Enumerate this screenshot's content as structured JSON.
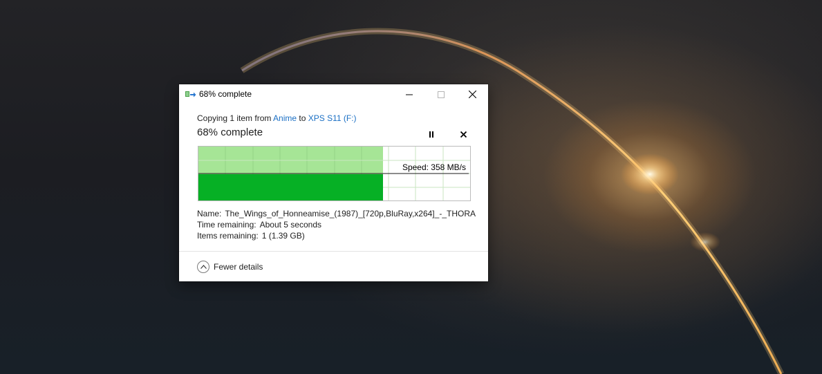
{
  "window": {
    "title": "68% complete"
  },
  "copy": {
    "prefix": "Copying 1 item from ",
    "source": "Anime",
    "connector": " to ",
    "destination": "XPS S11 (F:)"
  },
  "progress": {
    "heading": "68% complete",
    "percent": 68,
    "speed_label": "Speed: 358 MB/s"
  },
  "details": {
    "name_label": "Name:",
    "name_value": "The_Wings_of_Honneamise_(1987)_[720p,BluRay,x264]_-_THORA",
    "time_label": "Time remaining:",
    "time_value": "About 5 seconds",
    "items_label": "Items remaining:",
    "items_value": "1 (1.39 GB)"
  },
  "footer": {
    "toggle_label": "Fewer details"
  },
  "colors": {
    "progress_light": "#a6e596",
    "progress_dark": "#06b025",
    "grid_line": "#c8e6c0",
    "link": "#1a6fc4"
  },
  "icons": {
    "app": "file-copy-icon",
    "minimize": "minimize-icon",
    "maximize": "maximize-icon",
    "close": "close-icon",
    "pause": "pause-icon",
    "cancel": "cancel-icon",
    "chevron": "chevron-up-icon"
  }
}
